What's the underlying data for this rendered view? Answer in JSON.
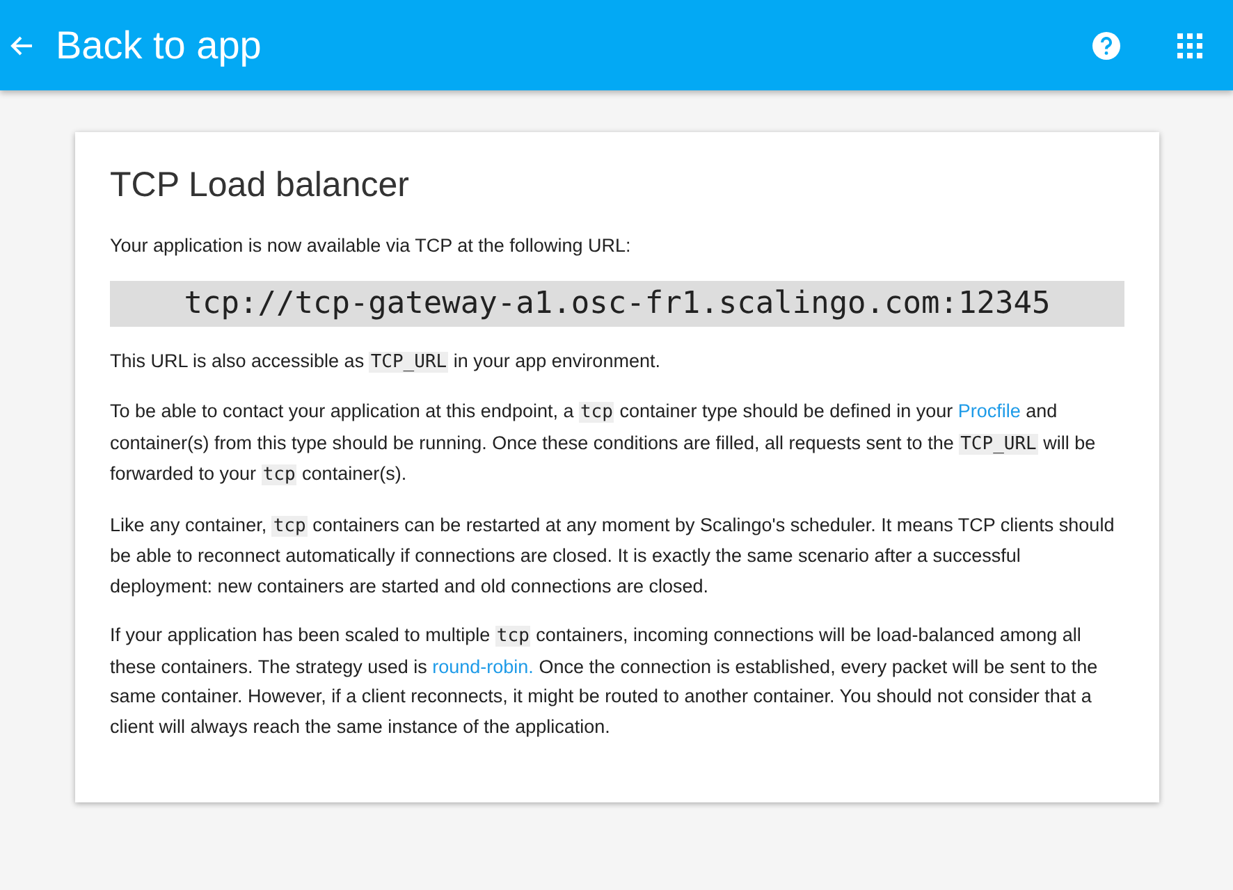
{
  "header": {
    "back_label": "Back to app"
  },
  "card": {
    "title": "TCP Load balancer",
    "intro": "Your application is now available via TCP at the following URL:",
    "url": "tcp://tcp-gateway-a1.osc-fr1.scalingo.com:12345",
    "paragraphs": [
      [
        {
          "kind": "text",
          "text": "This URL is also accessible as "
        },
        {
          "kind": "code",
          "text": "TCP_URL"
        },
        {
          "kind": "text",
          "text": " in your app environment."
        }
      ],
      [
        {
          "kind": "text",
          "text": "To be able to contact your application at this endpoint, a "
        },
        {
          "kind": "code",
          "text": "tcp"
        },
        {
          "kind": "text",
          "text": " container type should be defined in your "
        },
        {
          "kind": "link",
          "text": "Procfile"
        },
        {
          "kind": "text",
          "text": " and container(s) from this type should be running. Once these conditions are filled, all requests sent to the "
        },
        {
          "kind": "code",
          "text": "TCP_URL"
        },
        {
          "kind": "text",
          "text": " will be forwarded to your "
        },
        {
          "kind": "code",
          "text": "tcp"
        },
        {
          "kind": "text",
          "text": " container(s)."
        }
      ],
      [
        {
          "kind": "text",
          "text": "Like any container, "
        },
        {
          "kind": "code",
          "text": "tcp"
        },
        {
          "kind": "text",
          "text": " containers can be restarted at any moment by Scalingo's scheduler. It means TCP clients should be able to reconnect automatically if connections are closed. It is exactly the same scenario after a successful deployment: new containers are started and old connections are closed."
        }
      ],
      [
        {
          "kind": "text",
          "text": "If your application has been scaled to multiple "
        },
        {
          "kind": "code",
          "text": "tcp"
        },
        {
          "kind": "text",
          "text": " containers, incoming connections will be load-balanced among all these containers. The strategy used is "
        },
        {
          "kind": "link",
          "text": "round-robin."
        },
        {
          "kind": "text",
          "text": " Once the connection is established, every packet will be sent to the same container. However, if a client reconnects, it might be routed to another container. You should not consider that a client will always reach the same instance of the application."
        }
      ]
    ]
  }
}
